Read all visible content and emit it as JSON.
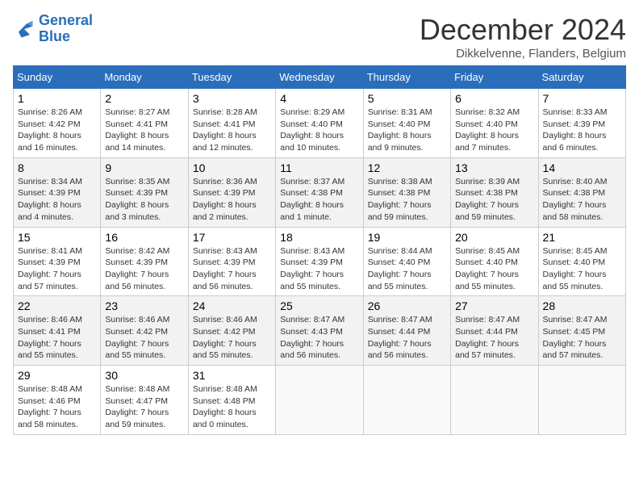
{
  "logo": {
    "line1": "General",
    "line2": "Blue"
  },
  "title": "December 2024",
  "subtitle": "Dikkelvenne, Flanders, Belgium",
  "days_of_week": [
    "Sunday",
    "Monday",
    "Tuesday",
    "Wednesday",
    "Thursday",
    "Friday",
    "Saturday"
  ],
  "weeks": [
    [
      {
        "day": "1",
        "info": "Sunrise: 8:26 AM\nSunset: 4:42 PM\nDaylight: 8 hours\nand 16 minutes."
      },
      {
        "day": "2",
        "info": "Sunrise: 8:27 AM\nSunset: 4:41 PM\nDaylight: 8 hours\nand 14 minutes."
      },
      {
        "day": "3",
        "info": "Sunrise: 8:28 AM\nSunset: 4:41 PM\nDaylight: 8 hours\nand 12 minutes."
      },
      {
        "day": "4",
        "info": "Sunrise: 8:29 AM\nSunset: 4:40 PM\nDaylight: 8 hours\nand 10 minutes."
      },
      {
        "day": "5",
        "info": "Sunrise: 8:31 AM\nSunset: 4:40 PM\nDaylight: 8 hours\nand 9 minutes."
      },
      {
        "day": "6",
        "info": "Sunrise: 8:32 AM\nSunset: 4:40 PM\nDaylight: 8 hours\nand 7 minutes."
      },
      {
        "day": "7",
        "info": "Sunrise: 8:33 AM\nSunset: 4:39 PM\nDaylight: 8 hours\nand 6 minutes."
      }
    ],
    [
      {
        "day": "8",
        "info": "Sunrise: 8:34 AM\nSunset: 4:39 PM\nDaylight: 8 hours\nand 4 minutes."
      },
      {
        "day": "9",
        "info": "Sunrise: 8:35 AM\nSunset: 4:39 PM\nDaylight: 8 hours\nand 3 minutes."
      },
      {
        "day": "10",
        "info": "Sunrise: 8:36 AM\nSunset: 4:39 PM\nDaylight: 8 hours\nand 2 minutes."
      },
      {
        "day": "11",
        "info": "Sunrise: 8:37 AM\nSunset: 4:38 PM\nDaylight: 8 hours\nand 1 minute."
      },
      {
        "day": "12",
        "info": "Sunrise: 8:38 AM\nSunset: 4:38 PM\nDaylight: 7 hours\nand 59 minutes."
      },
      {
        "day": "13",
        "info": "Sunrise: 8:39 AM\nSunset: 4:38 PM\nDaylight: 7 hours\nand 59 minutes."
      },
      {
        "day": "14",
        "info": "Sunrise: 8:40 AM\nSunset: 4:38 PM\nDaylight: 7 hours\nand 58 minutes."
      }
    ],
    [
      {
        "day": "15",
        "info": "Sunrise: 8:41 AM\nSunset: 4:39 PM\nDaylight: 7 hours\nand 57 minutes."
      },
      {
        "day": "16",
        "info": "Sunrise: 8:42 AM\nSunset: 4:39 PM\nDaylight: 7 hours\nand 56 minutes."
      },
      {
        "day": "17",
        "info": "Sunrise: 8:43 AM\nSunset: 4:39 PM\nDaylight: 7 hours\nand 56 minutes."
      },
      {
        "day": "18",
        "info": "Sunrise: 8:43 AM\nSunset: 4:39 PM\nDaylight: 7 hours\nand 55 minutes."
      },
      {
        "day": "19",
        "info": "Sunrise: 8:44 AM\nSunset: 4:40 PM\nDaylight: 7 hours\nand 55 minutes."
      },
      {
        "day": "20",
        "info": "Sunrise: 8:45 AM\nSunset: 4:40 PM\nDaylight: 7 hours\nand 55 minutes."
      },
      {
        "day": "21",
        "info": "Sunrise: 8:45 AM\nSunset: 4:40 PM\nDaylight: 7 hours\nand 55 minutes."
      }
    ],
    [
      {
        "day": "22",
        "info": "Sunrise: 8:46 AM\nSunset: 4:41 PM\nDaylight: 7 hours\nand 55 minutes."
      },
      {
        "day": "23",
        "info": "Sunrise: 8:46 AM\nSunset: 4:42 PM\nDaylight: 7 hours\nand 55 minutes."
      },
      {
        "day": "24",
        "info": "Sunrise: 8:46 AM\nSunset: 4:42 PM\nDaylight: 7 hours\nand 55 minutes."
      },
      {
        "day": "25",
        "info": "Sunrise: 8:47 AM\nSunset: 4:43 PM\nDaylight: 7 hours\nand 56 minutes."
      },
      {
        "day": "26",
        "info": "Sunrise: 8:47 AM\nSunset: 4:44 PM\nDaylight: 7 hours\nand 56 minutes."
      },
      {
        "day": "27",
        "info": "Sunrise: 8:47 AM\nSunset: 4:44 PM\nDaylight: 7 hours\nand 57 minutes."
      },
      {
        "day": "28",
        "info": "Sunrise: 8:47 AM\nSunset: 4:45 PM\nDaylight: 7 hours\nand 57 minutes."
      }
    ],
    [
      {
        "day": "29",
        "info": "Sunrise: 8:48 AM\nSunset: 4:46 PM\nDaylight: 7 hours\nand 58 minutes."
      },
      {
        "day": "30",
        "info": "Sunrise: 8:48 AM\nSunset: 4:47 PM\nDaylight: 7 hours\nand 59 minutes."
      },
      {
        "day": "31",
        "info": "Sunrise: 8:48 AM\nSunset: 4:48 PM\nDaylight: 8 hours\nand 0 minutes."
      },
      {
        "day": "",
        "info": ""
      },
      {
        "day": "",
        "info": ""
      },
      {
        "day": "",
        "info": ""
      },
      {
        "day": "",
        "info": ""
      }
    ]
  ]
}
